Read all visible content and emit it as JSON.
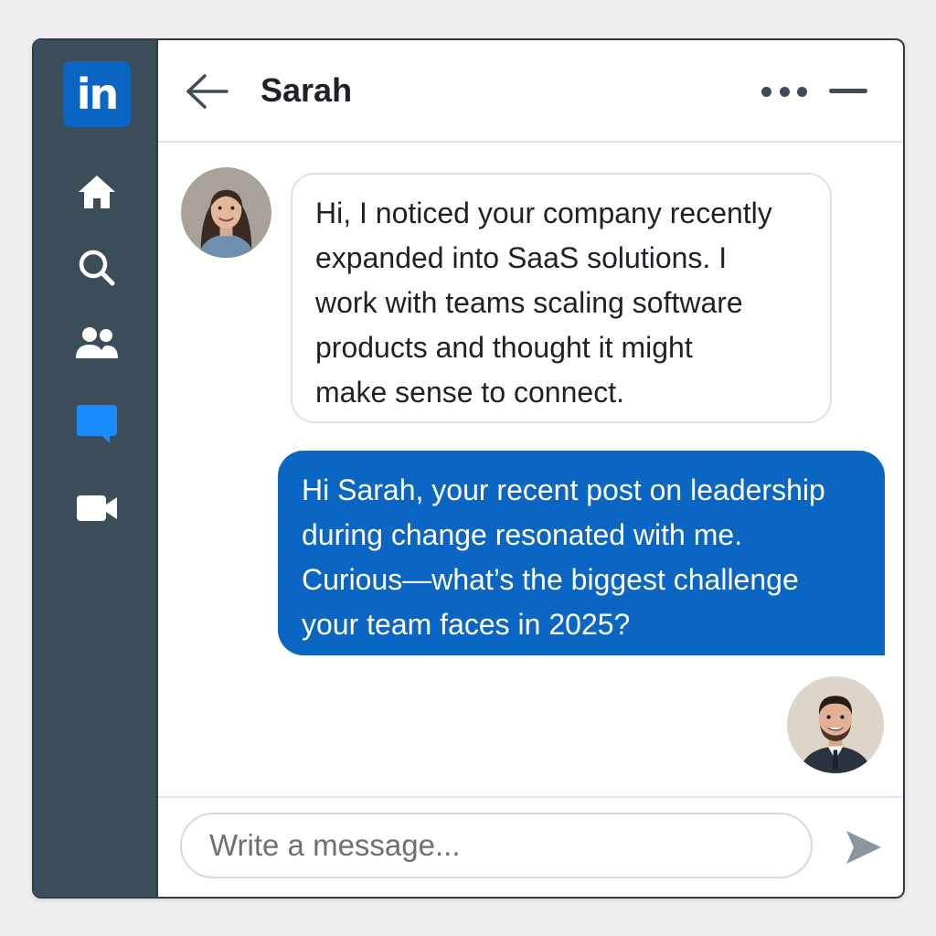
{
  "app": {
    "logo_text": "in",
    "brand_color": "#0a66c2",
    "sidebar_color": "#3c4d5a"
  },
  "sidebar": {
    "items": [
      {
        "icon": "home-icon"
      },
      {
        "icon": "search-icon"
      },
      {
        "icon": "network-icon"
      },
      {
        "icon": "messaging-icon",
        "active": true,
        "active_color": "#0a84ff"
      },
      {
        "icon": "video-icon"
      }
    ]
  },
  "header": {
    "title": "Sarah",
    "back_icon": "arrow-left-icon",
    "more_icon": "more-horizontal-icon",
    "minimize_icon": "minimize-icon"
  },
  "messages": [
    {
      "sender": "Sarah",
      "direction": "incoming",
      "lines": [
        "Hi, I noticed your company recently",
        "expanded into SaaS solutions. I",
        "work with teams scaling software",
        "products and thought it might",
        "make sense to connect."
      ]
    },
    {
      "sender": "me",
      "direction": "outgoing",
      "lines": [
        "Hi Sarah, your recent post on leadership",
        "during change resonated with me.",
        "Curious—what’s the biggest challenge",
        "your team faces in 2025?"
      ]
    }
  ],
  "composer": {
    "placeholder": "Write a message...",
    "value": "",
    "send_icon": "send-icon"
  }
}
